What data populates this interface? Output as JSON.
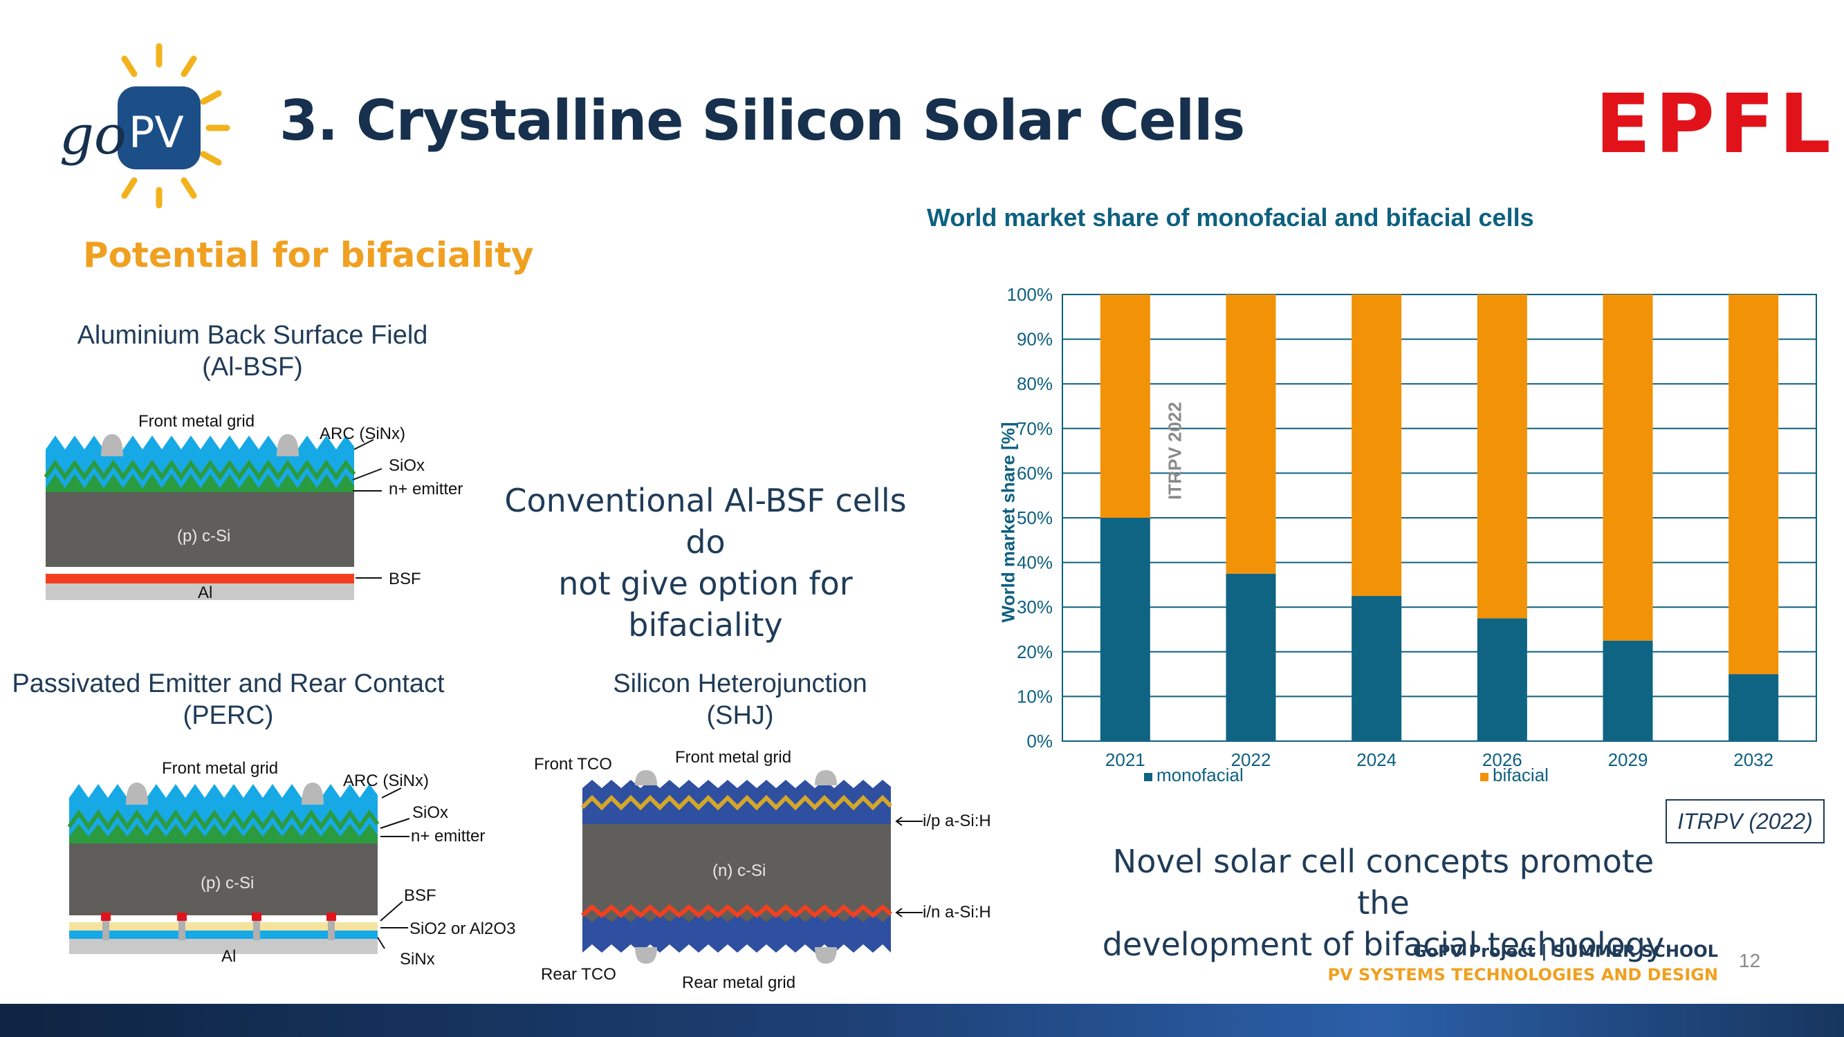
{
  "header": {
    "title": "3. Crystalline Silicon Solar Cells",
    "logo_text_go": "go",
    "logo_text_pv": "PV",
    "institution": "EPFL"
  },
  "subtitle": "Potential for bifaciality",
  "diagrams": {
    "albsf": {
      "title_line1": "Aluminium Back Surface Field",
      "title_line2": "(Al-BSF)",
      "labels": {
        "front_grid": "Front metal grid",
        "arc": "ARC (SiNx)",
        "siox": "SiOx",
        "emitter": "n+ emitter",
        "bulk": "(p) c-Si",
        "bsf": "BSF",
        "al": "Al"
      }
    },
    "perc": {
      "title_line1": "Passivated Emitter and Rear Contact",
      "title_line2": "(PERC)",
      "labels": {
        "front_grid": "Front metal grid",
        "arc": "ARC (SiNx)",
        "siox": "SiOx",
        "emitter": "n+ emitter",
        "bulk": "(p) c-Si",
        "bsf": "BSF",
        "sio2": "SiO2 or Al2O3",
        "sinx": "SiNx",
        "al": "Al"
      }
    },
    "shj": {
      "title_line1": "Silicon Heterojunction",
      "title_line2": "(SHJ)",
      "labels": {
        "front_tco": "Front TCO",
        "front_grid": "Front metal grid",
        "ip": "i/p a-Si:H",
        "bulk": "(n) c-Si",
        "in": "i/n a-Si:H",
        "rear_tco": "Rear TCO",
        "rear_grid": "Rear metal grid"
      }
    }
  },
  "messages": {
    "conventional_line1": "Conventional Al-BSF cells do",
    "conventional_line2": "not give option for bifaciality",
    "novel_line1": "Novel solar cell concepts promote the",
    "novel_line2": "development of bifacial technology"
  },
  "chart_data": {
    "type": "bar",
    "stacked": true,
    "title": "World market share of monofacial and bifacial cells",
    "ylabel": "World market share [%]",
    "ylim": [
      0,
      100
    ],
    "yticks": [
      "0%",
      "10%",
      "20%",
      "30%",
      "40%",
      "50%",
      "60%",
      "70%",
      "80%",
      "90%",
      "100%"
    ],
    "categories": [
      "2021",
      "2022",
      "2024",
      "2026",
      "2029",
      "2032"
    ],
    "series": [
      {
        "name": "monofacial",
        "values": [
          50,
          37.5,
          32.5,
          27.5,
          22.5,
          15
        ],
        "color": "#0e6482"
      },
      {
        "name": "bifacial",
        "values": [
          50,
          62.5,
          67.5,
          72.5,
          77.5,
          85
        ],
        "color": "#f29207"
      }
    ],
    "annotation": "ITRPV 2022",
    "grid": true,
    "legend": "bottom"
  },
  "source": "ITRPV (2022)",
  "footer": {
    "line1": "GoPV Project | SUMMER SCHOOL",
    "line2": "PV SYSTEMS TECHNOLOGIES AND DESIGN",
    "page": "12"
  },
  "colors": {
    "title": "#16304d",
    "accent_orange": "#f0a020",
    "epfl_red": "#e1121a",
    "arc_blue": "#17a9e6",
    "emitter_green": "#2b9b3f",
    "silicon_gray": "#5f5e5b",
    "bsf_red": "#f2401f",
    "aluminium_gray": "#c9c9c9",
    "tco_blue": "#2f4fa0"
  }
}
